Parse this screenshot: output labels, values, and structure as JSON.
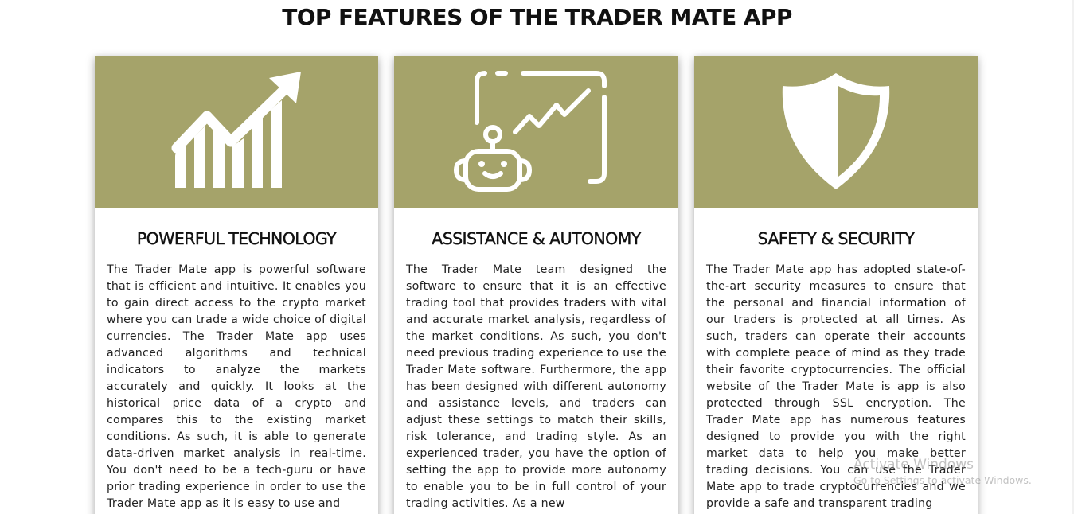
{
  "page": {
    "title": "TOP FEATURES OF THE TRADER MATE APP"
  },
  "colors": {
    "hero_background": "#a5a36a",
    "icon": "#ffffff",
    "text": "#222222"
  },
  "cards": [
    {
      "icon": "growth-chart-icon",
      "title": "POWERFUL TECHNOLOGY",
      "body": "The Trader Mate app is powerful software that is efficient and intuitive. It enables you to gain direct access to the crypto market where you can trade a wide choice of digital currencies. The Trader Mate app uses advanced algorithms and technical indicators to analyze the markets accurately and quickly. It looks at the historical price data of a crypto and compares this to the existing market conditions. As such, it is able to generate data-driven market analysis in real-time. You don't need to be a tech-guru or have prior trading experience in order to use the Trader Mate app as it is easy to use and"
    },
    {
      "icon": "robot-chart-icon",
      "title": "ASSISTANCE & AUTONOMY",
      "body": "The Trader Mate team designed the software to ensure that it is an effective trading tool that provides traders with vital and accurate market analysis, regardless of the market conditions. As such, you don't need previous trading experience to use the Trader Mate software. Furthermore, the app has been designed with different autonomy and assistance levels, and traders can adjust these settings to match their skills, risk tolerance, and trading style. As an experienced trader, you have the option of setting the app to provide more autonomy to enable you to be in full control of your trading activities. As a new"
    },
    {
      "icon": "shield-icon",
      "title": "SAFETY & SECURITY",
      "body": "The Trader Mate app has adopted state-of-the-art security measures to ensure that the personal and financial information of our traders is protected at all times. As such, traders can operate their accounts with complete peace of mind as they trade their favorite cryptocurrencies. The official website of the Trader Mate is app is also protected through SSL encryption. The Trader Mate app has numerous features designed to provide you with the right market data to help you make better trading decisions. You can use the Trader Mate app to trade cryptocurrencies and we provide a safe and transparent trading"
    }
  ],
  "watermark": {
    "title": "Activate Windows",
    "subtitle": "Go to Settings to activate Windows."
  }
}
